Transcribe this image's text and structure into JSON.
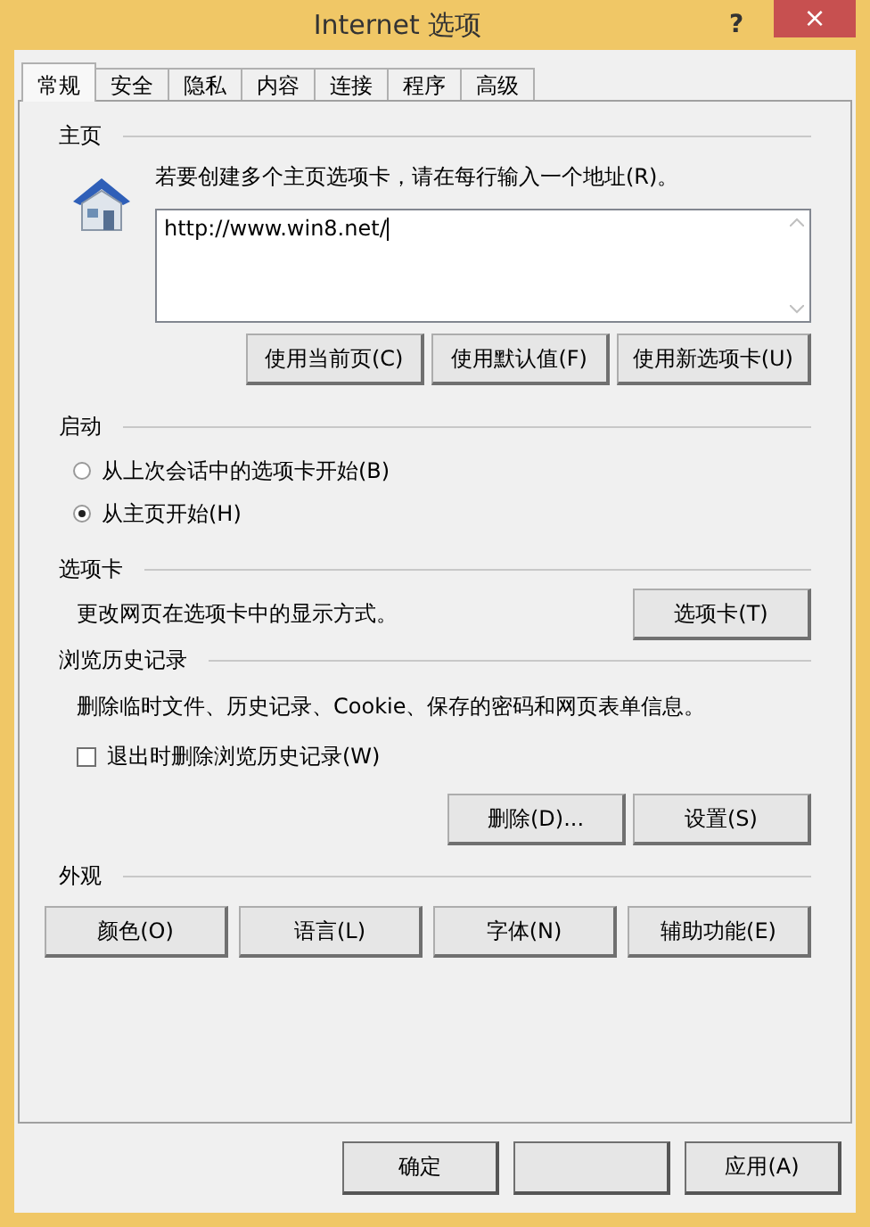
{
  "window": {
    "title": "Internet 选项",
    "controls": [
      "?",
      "×"
    ]
  },
  "tabs": [
    {
      "label": "常规",
      "selected": true
    },
    {
      "label": "安全",
      "selected": false
    },
    {
      "label": "隐私",
      "selected": false
    },
    {
      "label": "内容",
      "selected": false
    },
    {
      "label": "连接",
      "selected": false
    },
    {
      "label": "程序",
      "selected": false
    },
    {
      "label": "高级",
      "selected": false
    }
  ],
  "home": {
    "heading": "主页",
    "instruction": "若要创建多个主页选项卡，请在每行输入一个地址(R)。",
    "value": "http://www.win8.net/",
    "buttons": [
      "使用当前页(C)",
      "使用默认值(F)",
      "使用新选项卡(U)"
    ]
  },
  "startup": {
    "heading": "启动",
    "options": [
      {
        "label": "从上次会话中的选项卡开始(B)",
        "selected": false
      },
      {
        "label": "从主页开始(H)",
        "selected": true
      }
    ]
  },
  "tab_settings": {
    "heading": "选项卡",
    "description": "更改网页在选项卡中的显示方式。",
    "button": "选项卡(T)"
  },
  "history": {
    "heading": "浏览历史记录",
    "description": "删除临时文件、历史记录、Cookie、保存的密码和网页表单信息。",
    "checkbox": {
      "label": "退出时删除浏览历史记录(W)",
      "checked": false
    },
    "buttons": [
      "删除(D)...",
      "设置(S)"
    ]
  },
  "appearance": {
    "heading": "外观",
    "buttons": [
      "颜色(O)",
      "语言(L)",
      "字体(N)",
      "辅助功能(E)"
    ]
  },
  "dialog_buttons": [
    {
      "kind": "labeled",
      "label": "确定"
    },
    {
      "kind": "blank"
    },
    {
      "kind": "labeled",
      "label": "应用(A)"
    }
  ]
}
